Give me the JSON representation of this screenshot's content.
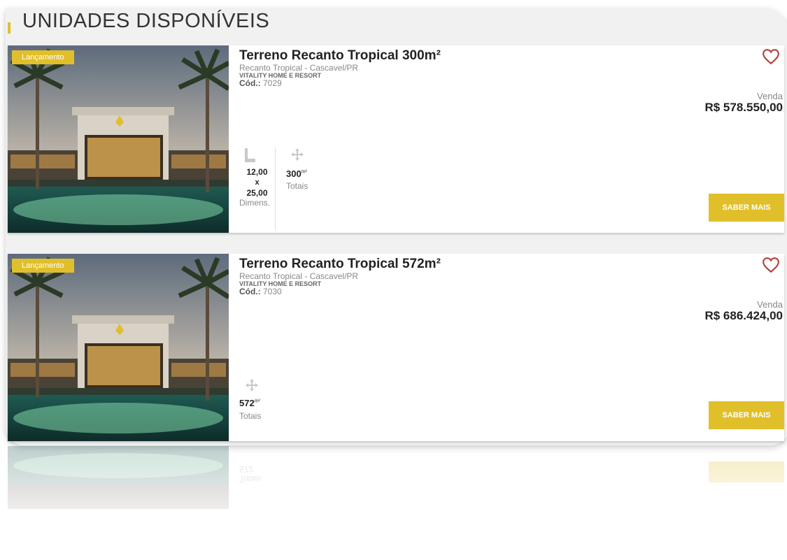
{
  "section": {
    "title": "UNIDADES DISPONÍVEIS"
  },
  "units": [
    {
      "badge": "Lançamento",
      "title": "Terreno Recanto Tropical 300m²",
      "location": "Recanto Tropical - Cascavel/PR",
      "developer": "VITALITY HOME E RESORT",
      "code_label": "Cód.:",
      "code": "7029",
      "price_label": "Venda",
      "price": "R$ 578.550,00",
      "button": "SABER MAIS",
      "dimensions": {
        "width": "12,00",
        "sep": "x",
        "depth": "25,00",
        "label": "Dimens."
      },
      "area": {
        "value": "300",
        "unit": "m²",
        "label": "Totais"
      }
    },
    {
      "badge": "Lançamento",
      "title": "Terreno Recanto Tropical 572m²",
      "location": "Recanto Tropical - Cascavel/PR",
      "developer": "VITALITY HOME E RESORT",
      "code_label": "Cód.:",
      "code": "7030",
      "price_label": "Venda",
      "price": "R$ 686.424,00",
      "button": "SABER MAIS",
      "area": {
        "value": "572",
        "unit": "m²",
        "label": "Totais"
      }
    }
  ],
  "colors": {
    "accent": "#e0bf2a",
    "heart": "#b5413f"
  },
  "icons": [
    "heart-icon",
    "ruler-icon",
    "move-arrows-icon"
  ]
}
